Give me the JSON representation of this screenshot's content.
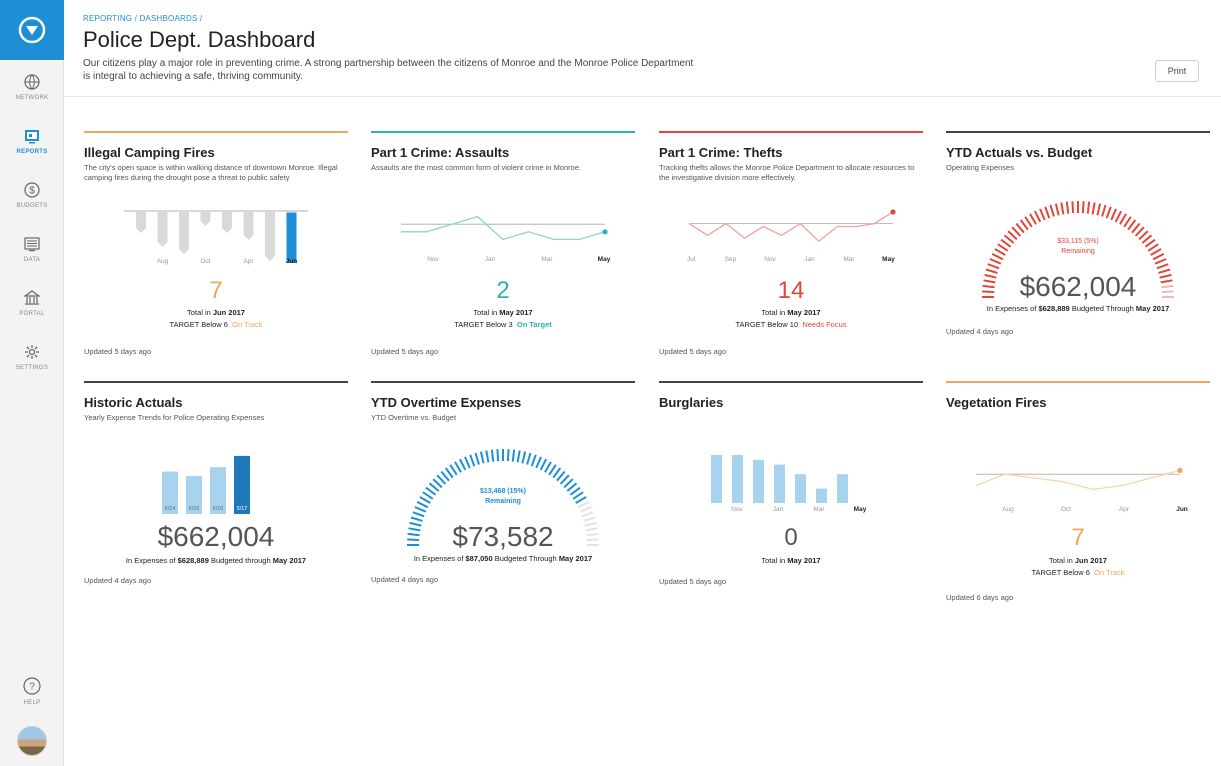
{
  "nav": {
    "items": [
      {
        "label": "NETWORK",
        "icon": "globe-icon"
      },
      {
        "label": "REPORTS",
        "icon": "reports-icon"
      },
      {
        "label": "BUDGETS",
        "icon": "dollar-icon"
      },
      {
        "label": "DATA",
        "icon": "data-icon"
      },
      {
        "label": "PORTAL",
        "icon": "portal-icon"
      },
      {
        "label": "SETTINGS",
        "icon": "gear-icon"
      }
    ],
    "help": "HELP",
    "active": "REPORTS"
  },
  "header": {
    "breadcrumb": "REPORTING / DASHBOARDS /",
    "title": "Police Dept. Dashboard",
    "description": "Our citizens play a major role in preventing crime. A strong partnership between the citizens of Monroe and the Monroe Police Department is integral to achieving a safe, thriving community.",
    "print_label": "Print"
  },
  "colors": {
    "accent": "#1e8fd5",
    "orange": "#f0a35b",
    "teal": "#2bb3b2",
    "red": "#e0463a",
    "dark": "#444444"
  },
  "cards": {
    "camping": {
      "title": "Illegal Camping Fires",
      "subtitle": "The city's open space is within walking distance of downtown Monroe. Illegal camping fires during the drought pose a threat to public safety",
      "value": "7",
      "total_prefix": "Total in ",
      "total_period": "Jun 2017",
      "target_label": "TARGET Below 6",
      "status": "On Track",
      "updated": "Updated 5 days ago"
    },
    "assaults": {
      "title": "Part 1 Crime: Assaults",
      "subtitle": "Assaults are the most common form of violent crime in Monroe.",
      "value": "2",
      "total_prefix": "Total in ",
      "total_period": "May 2017",
      "target_label": "TARGET Below 3",
      "status": "On Target",
      "updated": "Updated 5 days ago"
    },
    "thefts": {
      "title": "Part 1 Crime: Thefts",
      "subtitle": "Tracking thefts allows the Monroe Police Department to allocate resources to the investigative division more effectively.",
      "value": "14",
      "total_prefix": "Total in ",
      "total_period": "May 2017",
      "target_label": "TARGET Below 10",
      "status": "Needs Focus",
      "updated": "Updated 5 days ago"
    },
    "ytd_budget": {
      "title": "YTD Actuals vs. Budget",
      "subtitle": "Operating Expenses",
      "remaining_value": "$33,115 (5%)",
      "remaining_label": "Remaining",
      "value": "$662,004",
      "expense_prefix": "In Expenses of ",
      "expense_amount": "$628,889",
      "expense_mid": " Budgeted Through ",
      "expense_period": "May 2017",
      "remaining_fraction": 0.05,
      "updated": "Updated 4 days ago"
    },
    "historic": {
      "title": "Historic Actuals",
      "subtitle": "Yearly Expense Trends for Police Operating Expenses",
      "value": "$662,004",
      "expense_prefix": "In Expenses of ",
      "expense_amount": "$628,889",
      "expense_mid": " Budgeted through ",
      "expense_period": "May 2017",
      "updated": "Updated 4 days ago"
    },
    "overtime": {
      "title": "YTD Overtime Expenses",
      "subtitle": "YTD Overtime vs. Budget",
      "remaining_value": "$13,468 (15%)",
      "remaining_label": "Remaining",
      "value": "$73,582",
      "expense_prefix": "In Expenses of ",
      "expense_amount": "$87,050",
      "expense_mid": " Budgeted Through ",
      "expense_period": "May 2017",
      "remaining_fraction": 0.15,
      "updated": "Updated 4 days ago"
    },
    "burglaries": {
      "title": "Burglaries",
      "subtitle": "",
      "value": "0",
      "total_prefix": "Total in ",
      "total_period": "May 2017",
      "updated": "Updated 5 days ago"
    },
    "vegetation": {
      "title": "Vegetation Fires",
      "subtitle": "",
      "value": "7",
      "total_prefix": "Total in ",
      "total_period": "Jun 2017",
      "target_label": "TARGET Below 6",
      "status": "On Track",
      "updated": "Updated 6 days ago"
    }
  },
  "chart_data": [
    {
      "id": "camping",
      "type": "bar",
      "categories": [
        "",
        "Aug",
        "",
        "Oct",
        "",
        "Apr",
        "",
        "Jun"
      ],
      "values": [
        -2,
        -4,
        -5,
        -1,
        -2,
        -3,
        -6,
        7
      ],
      "target": 6
    },
    {
      "id": "assaults",
      "type": "line",
      "categories": [
        "Nov",
        "Jan",
        "Mar",
        "May"
      ],
      "values": [
        2,
        2,
        3,
        4,
        1,
        2,
        1,
        1,
        2
      ],
      "target": 3
    },
    {
      "id": "thefts",
      "type": "line",
      "categories": [
        "Jul",
        "Sep",
        "Nov",
        "Jan",
        "Mar",
        "May"
      ],
      "values": [
        10,
        6,
        10,
        5,
        9,
        6,
        10,
        4,
        9,
        9,
        10,
        14
      ],
      "target": 10
    },
    {
      "id": "historic",
      "type": "bar",
      "categories": [
        "5/14",
        "5/15",
        "5/16",
        "5/17"
      ],
      "values": [
        590,
        570,
        610,
        662
      ]
    },
    {
      "id": "burglaries",
      "type": "bar",
      "categories": [
        "Nov",
        "Jan",
        "Mar",
        "May"
      ],
      "values": [
        10,
        10,
        9,
        8,
        6,
        3,
        6,
        0
      ]
    },
    {
      "id": "vegetation",
      "type": "line",
      "categories": [
        "Aug",
        "Oct",
        "Apr",
        "Jun"
      ],
      "values": [
        3,
        6,
        5,
        4,
        2,
        3,
        5,
        7
      ],
      "target": 6
    }
  ]
}
